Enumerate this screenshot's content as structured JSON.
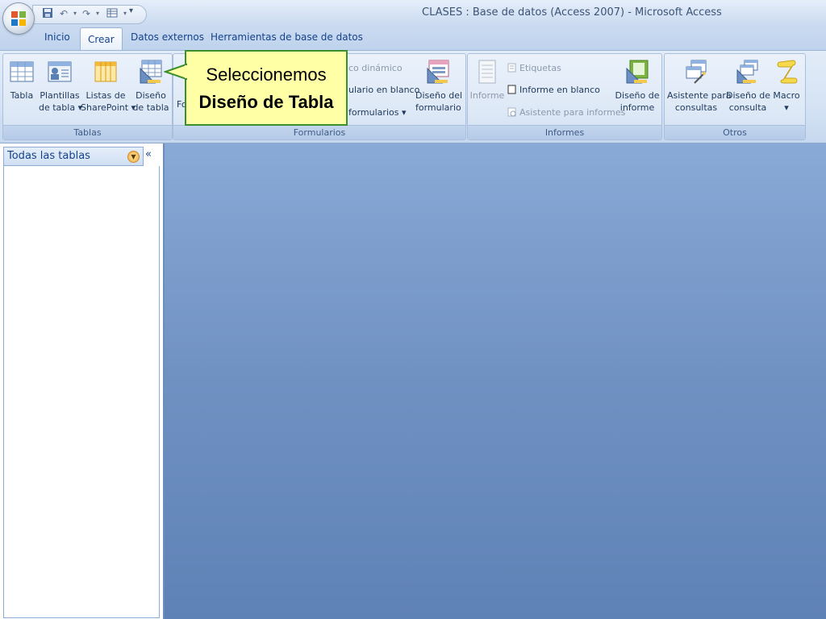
{
  "window": {
    "title": "CLASES : Base de datos (Access 2007) - Microsoft Access"
  },
  "tabs": [
    {
      "label": "Inicio"
    },
    {
      "label": "Crear"
    },
    {
      "label": "Datos externos"
    },
    {
      "label": "Herramientas de base de datos"
    }
  ],
  "active_tab": "Crear",
  "ribbon": {
    "tablas": {
      "label": "Tablas",
      "tabla": "Tabla",
      "plantillas_1": "Plantillas",
      "plantillas_2": "de tabla ▾",
      "listas_1": "Listas de",
      "listas_2": "SharePoint ▾",
      "diseno_1": "Diseño",
      "diseno_2": "de tabla"
    },
    "formularios": {
      "label": "Formularios",
      "f_partial": "Fo",
      "grafico": "co dinámico",
      "blanco": "ulario en blanco",
      "mas": "formularios ▾",
      "diseno_1": "Diseño del",
      "diseno_2": "formulario"
    },
    "informes": {
      "label": "Informes",
      "informe": "Informe",
      "etiquetas": "Etiquetas",
      "blanco": "Informe en blanco",
      "asistente": "Asistente para informes",
      "diseno_1": "Diseño de",
      "diseno_2": "informe"
    },
    "otros": {
      "label": "Otros",
      "asistente_1": "Asistente para",
      "asistente_2": "consultas",
      "diseno_1": "Diseño de",
      "diseno_2": "consulta",
      "macro_1": "Macro",
      "macro_2": "▾"
    }
  },
  "nav": {
    "title": "Todas las tablas",
    "collapse": "«"
  },
  "callout": {
    "line1": "Seleccionemos",
    "line2": "Diseño de Tabla"
  },
  "colors": {
    "callout_bg": "#ffffa6",
    "callout_border": "#3c8f2d",
    "workspace": "#6f91c2"
  }
}
